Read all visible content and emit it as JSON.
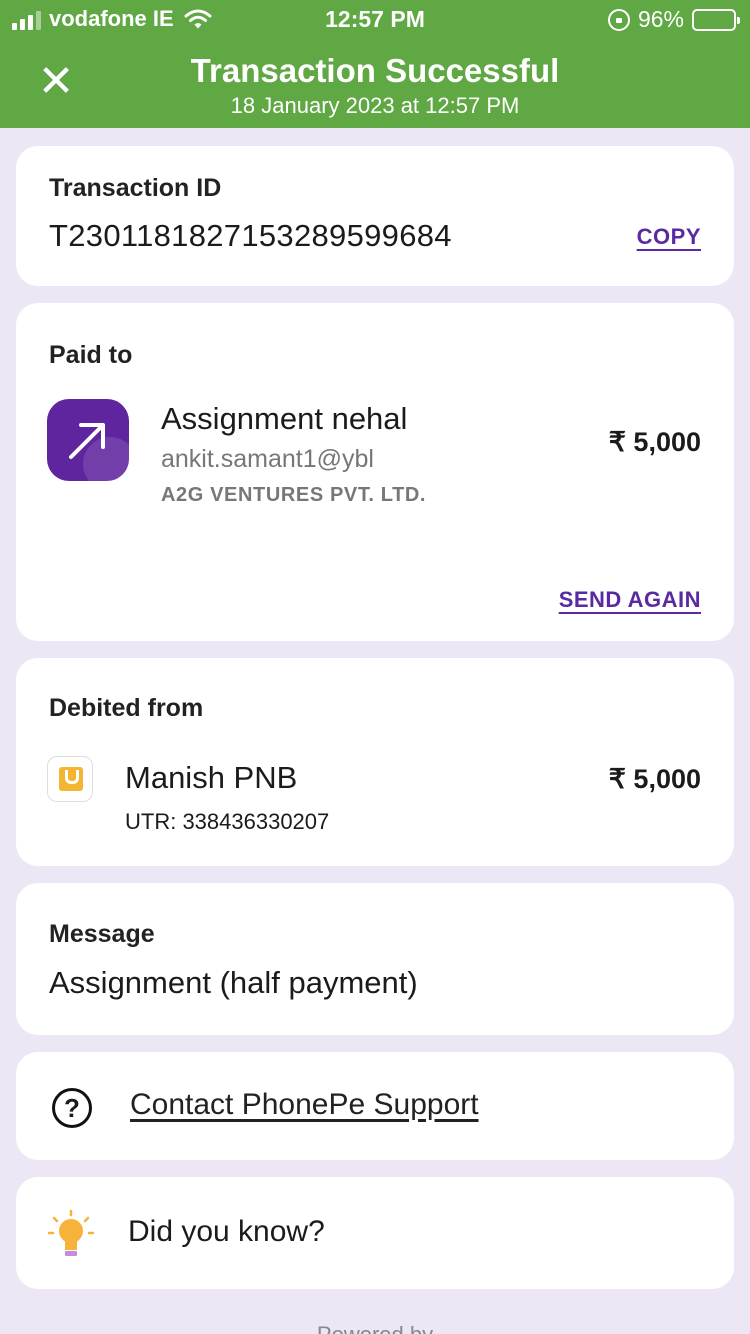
{
  "status_bar": {
    "carrier": "vodafone IE",
    "time": "12:57 PM",
    "battery": "96%",
    "battery_level": 0.96
  },
  "header": {
    "close_icon": "close-icon",
    "title": "Transaction Successful",
    "subtitle": "18 January 2023 at 12:57 PM",
    "color": "#5fa843"
  },
  "transaction": {
    "label": "Transaction ID",
    "id": "T2301181827153289599684",
    "copy_label": "COPY"
  },
  "paid_to": {
    "label": "Paid to",
    "name": "Assignment nehal",
    "upi_id": "ankit.samant1@ybl",
    "legal_name": "A2G VENTURES PVT. LTD.",
    "amount": "₹ 5,000",
    "send_again_label": "SEND AGAIN",
    "icon": "arrow-up-right-icon",
    "icon_color": "#5f259f"
  },
  "debited_from": {
    "label": "Debited from",
    "bank_name": "Manish PNB",
    "utr": "UTR: 338436330207",
    "amount": "₹ 5,000",
    "icon": "pnb-bank-icon"
  },
  "message": {
    "label": "Message",
    "text": "Assignment (half payment)"
  },
  "support": {
    "icon": "help-icon",
    "label": "Contact PhonePe Support"
  },
  "did_you_know": {
    "icon": "lightbulb-icon",
    "label": "Did you know?"
  },
  "footer": {
    "powered_by": "Powered by"
  },
  "accent_color": "#5a2aa0"
}
